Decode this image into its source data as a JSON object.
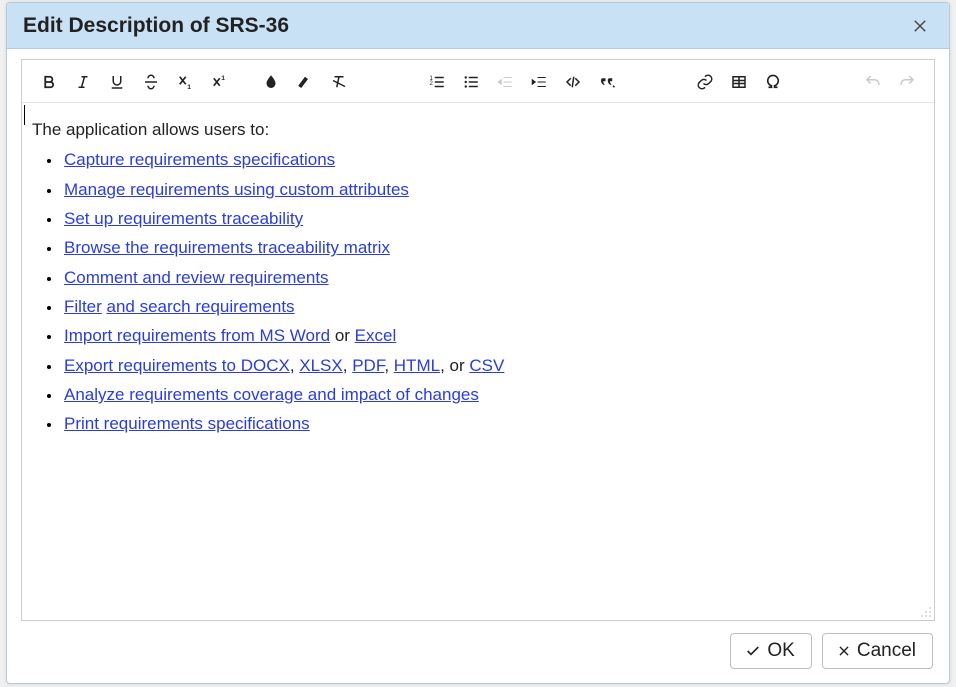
{
  "dialog": {
    "title": "Edit Description of SRS-36",
    "ok_label": "OK",
    "cancel_label": "Cancel"
  },
  "toolbar": {
    "bold": "Bold",
    "italic": "Italic",
    "underline": "Underline",
    "strike": "Strikethrough",
    "subscript": "Subscript",
    "superscript": "Superscript",
    "text_color": "Text Color",
    "highlight": "Highlight",
    "clear_format": "Clear Formatting",
    "ordered_list": "Ordered List",
    "unordered_list": "Unordered List",
    "outdent": "Decrease Indent",
    "indent": "Increase Indent",
    "code": "Code",
    "quote": "Quote",
    "link": "Insert Link",
    "table": "Insert Table",
    "special_char": "Special Character",
    "undo": "Undo",
    "redo": "Redo"
  },
  "content": {
    "intro": "The application allows users to:",
    "rows": [
      {
        "parts": [
          {
            "t": "link",
            "v": "Capture requirements specifications"
          }
        ]
      },
      {
        "parts": [
          {
            "t": "link",
            "v": "Manage requirements using custom attributes"
          }
        ]
      },
      {
        "parts": [
          {
            "t": "link",
            "v": "Set up requirements traceability"
          }
        ]
      },
      {
        "parts": [
          {
            "t": "link",
            "v": "Browse the requirements traceability matrix"
          }
        ]
      },
      {
        "parts": [
          {
            "t": "link",
            "v": "Comment and review requirements"
          }
        ]
      },
      {
        "parts": [
          {
            "t": "link",
            "v": "Filter"
          },
          {
            "t": "text",
            "v": " "
          },
          {
            "t": "link",
            "v": "and search requirements"
          }
        ]
      },
      {
        "parts": [
          {
            "t": "link",
            "v": "Import requirements from MS Word"
          },
          {
            "t": "text",
            "v": " or "
          },
          {
            "t": "link",
            "v": "Excel"
          }
        ]
      },
      {
        "parts": [
          {
            "t": "link",
            "v": "Export requirements to DOCX"
          },
          {
            "t": "text",
            "v": ", "
          },
          {
            "t": "link",
            "v": "XLSX"
          },
          {
            "t": "text",
            "v": ",  "
          },
          {
            "t": "link",
            "v": "PDF"
          },
          {
            "t": "text",
            "v": ", "
          },
          {
            "t": "link",
            "v": "HTML"
          },
          {
            "t": "text",
            "v": ", or "
          },
          {
            "t": "link",
            "v": "CSV"
          }
        ]
      },
      {
        "parts": [
          {
            "t": "link",
            "v": "Analyze requirements coverage and impact of changes"
          }
        ]
      },
      {
        "parts": [
          {
            "t": "link",
            "v": "Print requirements specifications"
          }
        ]
      }
    ]
  }
}
